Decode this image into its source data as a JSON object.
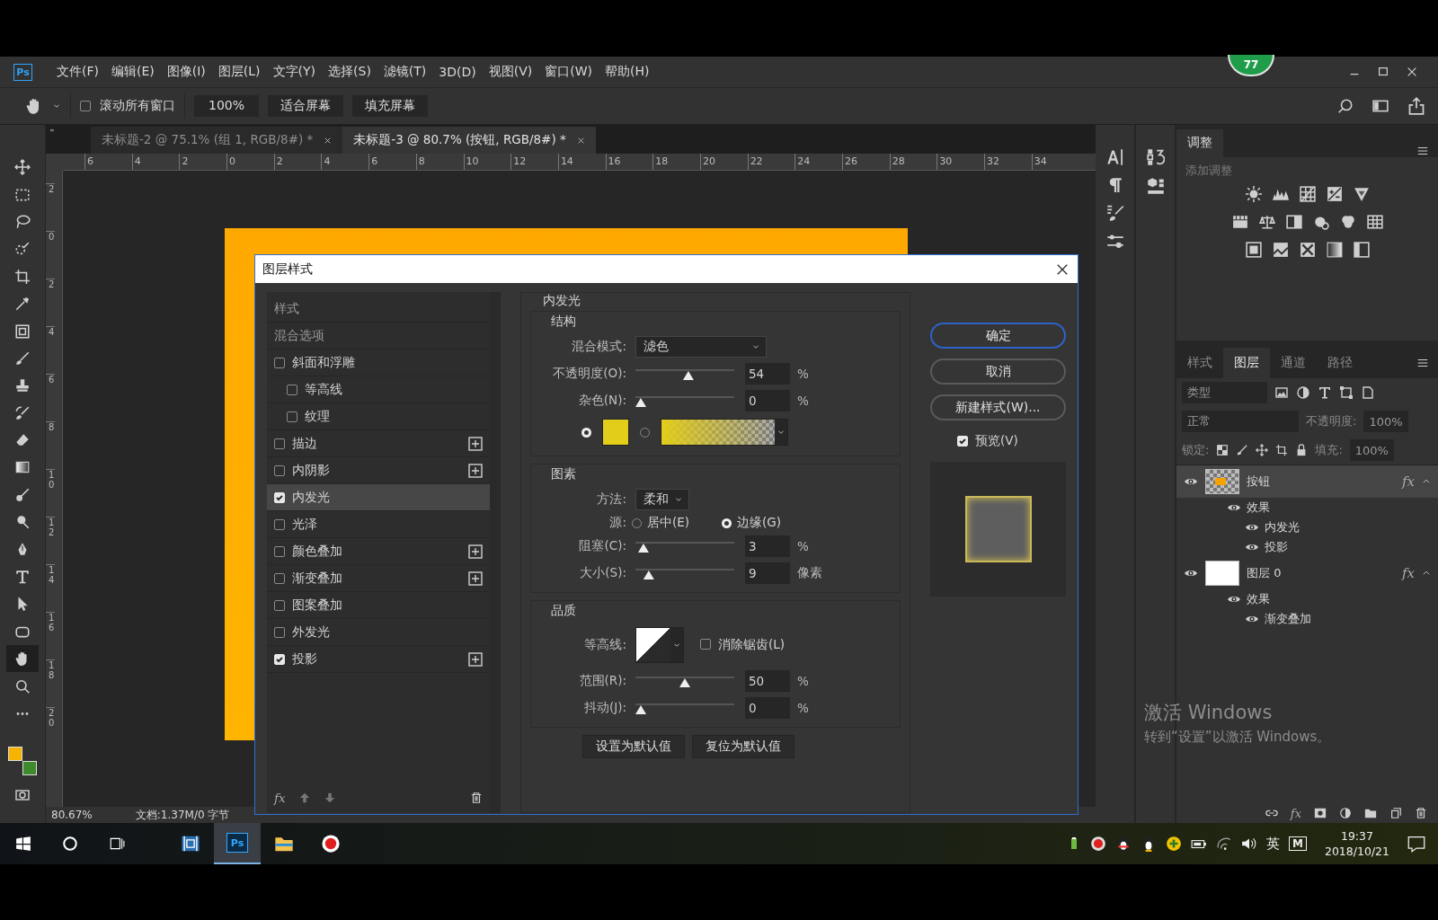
{
  "menu": {
    "logo": "Ps",
    "items": [
      "文件(F)",
      "编辑(E)",
      "图像(I)",
      "图层(L)",
      "文字(Y)",
      "选择(S)",
      "滤镜(T)",
      "3D(D)",
      "视图(V)",
      "窗口(W)",
      "帮助(H)"
    ],
    "badge": "77"
  },
  "options": {
    "scroll_all": {
      "label": "滚动所有窗口",
      "checked": false
    },
    "zoom": "100%",
    "buttons": [
      "适合屏幕",
      "填充屏幕"
    ]
  },
  "tools": [
    {
      "selected": false
    },
    {
      "selected": false
    },
    {
      "selected": false
    },
    {
      "selected": false
    },
    {
      "selected": false
    },
    {
      "selected": false
    },
    {
      "selected": false
    },
    {
      "selected": false
    },
    {
      "selected": false
    },
    {
      "selected": false
    },
    {
      "selected": false
    },
    {
      "selected": false
    },
    {
      "selected": false
    },
    {
      "selected": false
    },
    {
      "selected": false
    },
    {
      "selected": false
    },
    {
      "selected": false
    },
    {
      "selected": false
    },
    {
      "selected": true
    },
    {
      "selected": false
    },
    {
      "selected": false
    }
  ],
  "swatches": [
    {
      "color": "#f6b400"
    },
    {
      "color": "#3e8b2c"
    }
  ],
  "doc_tabs": [
    {
      "label": "未标题-2 @ 75.1% (组 1, RGB/8#) *",
      "selected": false
    },
    {
      "label": "未标题-3 @ 80.7% (按钮, RGB/8#) *",
      "selected": true
    }
  ],
  "rulers": {
    "horizontal": [
      "6",
      "4",
      "2",
      "0",
      "2",
      "4",
      "6",
      "8",
      "10",
      "12",
      "14",
      "16",
      "18",
      "20",
      "22",
      "24",
      "26",
      "28",
      "30",
      "32",
      "34"
    ],
    "vertical": [
      "2",
      "0",
      "2",
      "4",
      "6",
      "8",
      "10",
      "12",
      "14",
      "16",
      "18",
      "20"
    ]
  },
  "status_bar": {
    "zoom": "80.67%",
    "doc_size": "文档:1.37M/0 字节"
  },
  "dialog": {
    "title": "图层样式",
    "style_list": [
      {
        "label": "样式",
        "kind": "heading",
        "selected": false
      },
      {
        "label": "混合选项",
        "kind": "heading",
        "selected": false
      },
      {
        "label": "斜面和浮雕",
        "kind": "effect",
        "checked": false,
        "selected": false,
        "add_button": false
      },
      {
        "label": "等高线",
        "kind": "sub_effect",
        "checked": false,
        "selected": false,
        "add_button": false
      },
      {
        "label": "纹理",
        "kind": "sub_effect",
        "checked": false,
        "selected": false,
        "add_button": false
      },
      {
        "label": "描边",
        "kind": "effect",
        "checked": false,
        "selected": false,
        "add_button": true
      },
      {
        "label": "内阴影",
        "kind": "effect",
        "checked": false,
        "selected": false,
        "add_button": true
      },
      {
        "label": "内发光",
        "kind": "effect",
        "checked": true,
        "selected": true,
        "add_button": false
      },
      {
        "label": "光泽",
        "kind": "effect",
        "checked": false,
        "selected": false,
        "add_button": false
      },
      {
        "label": "颜色叠加",
        "kind": "effect",
        "checked": false,
        "selected": false,
        "add_button": true
      },
      {
        "label": "渐变叠加",
        "kind": "effect",
        "checked": false,
        "selected": false,
        "add_button": true
      },
      {
        "label": "图案叠加",
        "kind": "effect",
        "checked": false,
        "selected": false,
        "add_button": false
      },
      {
        "label": "外发光",
        "kind": "effect",
        "checked": false,
        "selected": false,
        "add_button": false
      },
      {
        "label": "投影",
        "kind": "effect",
        "checked": true,
        "selected": false,
        "add_button": true
      }
    ],
    "footer_mark": "fx",
    "section_title": "内发光",
    "structure": {
      "title": "结构",
      "blend_label": "混合模式:",
      "blend_mode": "滤色",
      "sliders": [
        {
          "label": "不透明度(O):",
          "level": 0.54,
          "value": "54",
          "unit": "%"
        },
        {
          "label": "杂色(N):",
          "level": 0,
          "value": "0",
          "unit": "%"
        }
      ],
      "fill_options": [
        {
          "kind": "solid",
          "selected": true,
          "color": "#e3cd1b"
        },
        {
          "kind": "gradient",
          "selected": false,
          "color": "#e3cd1b"
        }
      ]
    },
    "elements": {
      "title": "图素",
      "method_label": "方法:",
      "method": "柔和",
      "source_label": "源:",
      "sources": [
        {
          "label": "居中(E)",
          "selected": false
        },
        {
          "label": "边缘(G)",
          "selected": true
        }
      ],
      "sliders": [
        {
          "label": "阻塞(C):",
          "level": 0.03,
          "value": "3",
          "unit": "%"
        },
        {
          "label": "大小(S):",
          "level": 0.09,
          "value": "9",
          "unit": "像素"
        }
      ]
    },
    "quality": {
      "title": "品质",
      "contour_label": "等高线:",
      "anti_alias": {
        "label": "消除锯齿(L)",
        "checked": false
      },
      "sliders": [
        {
          "label": "范围(R):",
          "level": 0.5,
          "value": "50",
          "unit": "%"
        },
        {
          "label": "抖动(J):",
          "level": 0,
          "value": "0",
          "unit": "%"
        }
      ]
    },
    "default_buttons": [
      "设置为默认值",
      "复位为默认值"
    ],
    "buttons": [
      {
        "label": "确定",
        "selected": true
      },
      {
        "label": "取消",
        "selected": false
      },
      {
        "label": "新建样式(W)...",
        "selected": false
      }
    ],
    "preview": {
      "label": "预览(V)",
      "checked": true
    }
  },
  "adjustments": {
    "tab": "调整",
    "subtitle": "添加调整"
  },
  "layers_panel": {
    "tabs": [
      {
        "label": "样式",
        "selected": false
      },
      {
        "label": "图层",
        "selected": true
      },
      {
        "label": "通道",
        "selected": false
      },
      {
        "label": "路径",
        "selected": false
      }
    ],
    "footer_fx": "fx",
    "filter": "类型",
    "blend_mode": "正常",
    "opacity_label": "不透明度:",
    "opacity": "100%",
    "lock_label": "锁定:",
    "fill_label": "填充:",
    "fill": "100%",
    "layers": [
      {
        "name": "按钮",
        "kind": "shape",
        "selected": true,
        "visible": true,
        "fx": "fx",
        "expanded": true,
        "children": [
          {
            "name": "效果",
            "visible": true,
            "children": [
              {
                "name": "内发光",
                "visible": true
              },
              {
                "name": "投影",
                "visible": true
              }
            ]
          }
        ]
      },
      {
        "name": "图层 0",
        "kind": "plain",
        "selected": false,
        "visible": true,
        "fx": "fx",
        "expanded": true,
        "children": [
          {
            "name": "效果",
            "visible": true,
            "children": [
              {
                "name": "渐变叠加",
                "visible": true
              }
            ]
          }
        ]
      }
    ]
  },
  "windows_notice": {
    "title": "激活 Windows",
    "text": "转到“设置”以激活 Windows。"
  },
  "taskbar": {
    "ps": "Ps",
    "ime": "英",
    "ime_mode": "M",
    "time": "19:37",
    "date": "2018/10/21"
  }
}
